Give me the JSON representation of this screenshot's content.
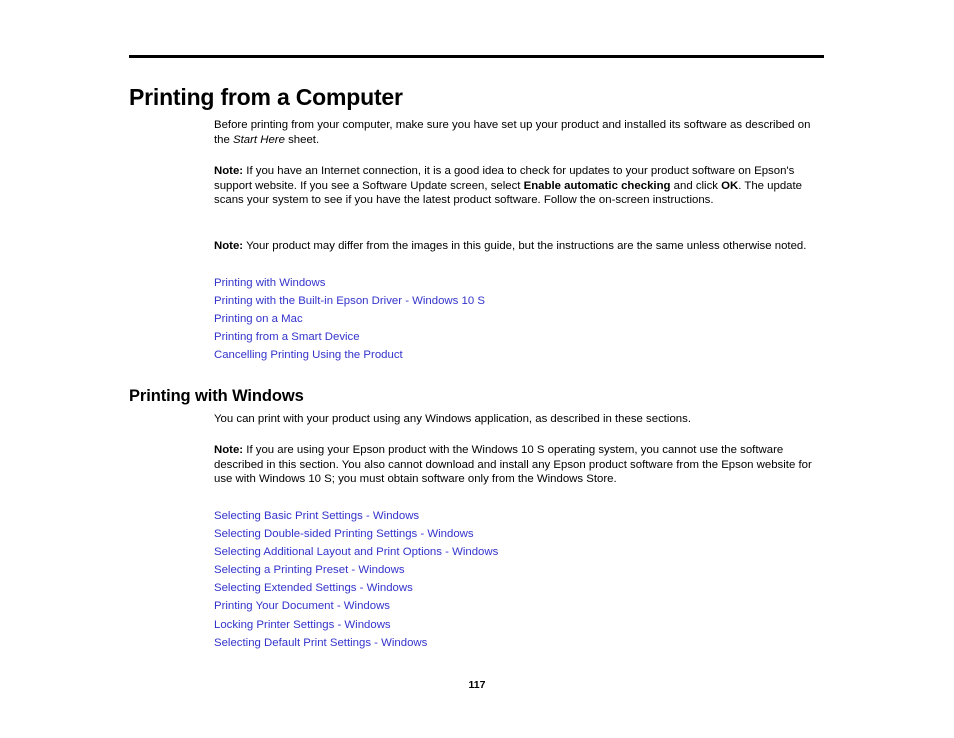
{
  "document": {
    "chapter_title": "Printing from a Computer",
    "page_number": "117",
    "link_color": "#3333CC",
    "text_color": "#000000",
    "background_color": "#FFFFFF"
  },
  "intro": {
    "part1": "Before printing from your computer, make sure you have set up your product and installed its software as described on the ",
    "italic": "Start Here",
    "part2": " sheet."
  },
  "note1": {
    "label": "Note:",
    "part1": " If you have an Internet connection, it is a good idea to check for updates to your product software on Epson's support website. If you see a Software Update screen, select ",
    "bold1": "Enable automatic checking",
    "part2": " and click ",
    "bold2": "OK",
    "part3": ". The update scans your system to see if you have the latest product software. Follow the on-screen instructions."
  },
  "note2": {
    "label": "Note:",
    "text": " Your product may differ from the images in this guide, but the instructions are the same unless otherwise noted."
  },
  "toc_main": {
    "links": [
      {
        "label": "Printing with Windows"
      },
      {
        "label": "Printing with the Built-in Epson Driver - Windows 10 S"
      },
      {
        "label": "Printing on a Mac"
      },
      {
        "label": "Printing from a Smart Device"
      },
      {
        "label": "Cancelling Printing Using the Product"
      }
    ]
  },
  "section_windows": {
    "heading": "Printing with Windows",
    "intro": "You can print with your product using any Windows application, as described in these sections."
  },
  "note3": {
    "label": "Note:",
    "text": " If you are using your Epson product with the Windows 10 S operating system, you cannot use the software described in this section. You also cannot download and install any Epson product software from the Epson website for use with Windows 10 S; you must obtain software only from the Windows Store."
  },
  "toc_windows": {
    "links": [
      {
        "label": "Selecting Basic Print Settings - Windows"
      },
      {
        "label": "Selecting Double-sided Printing Settings - Windows"
      },
      {
        "label": "Selecting Additional Layout and Print Options - Windows"
      },
      {
        "label": "Selecting a Printing Preset - Windows"
      },
      {
        "label": "Selecting Extended Settings - Windows"
      },
      {
        "label": "Printing Your Document - Windows"
      },
      {
        "label": "Locking Printer Settings - Windows"
      },
      {
        "label": "Selecting Default Print Settings - Windows"
      }
    ]
  }
}
